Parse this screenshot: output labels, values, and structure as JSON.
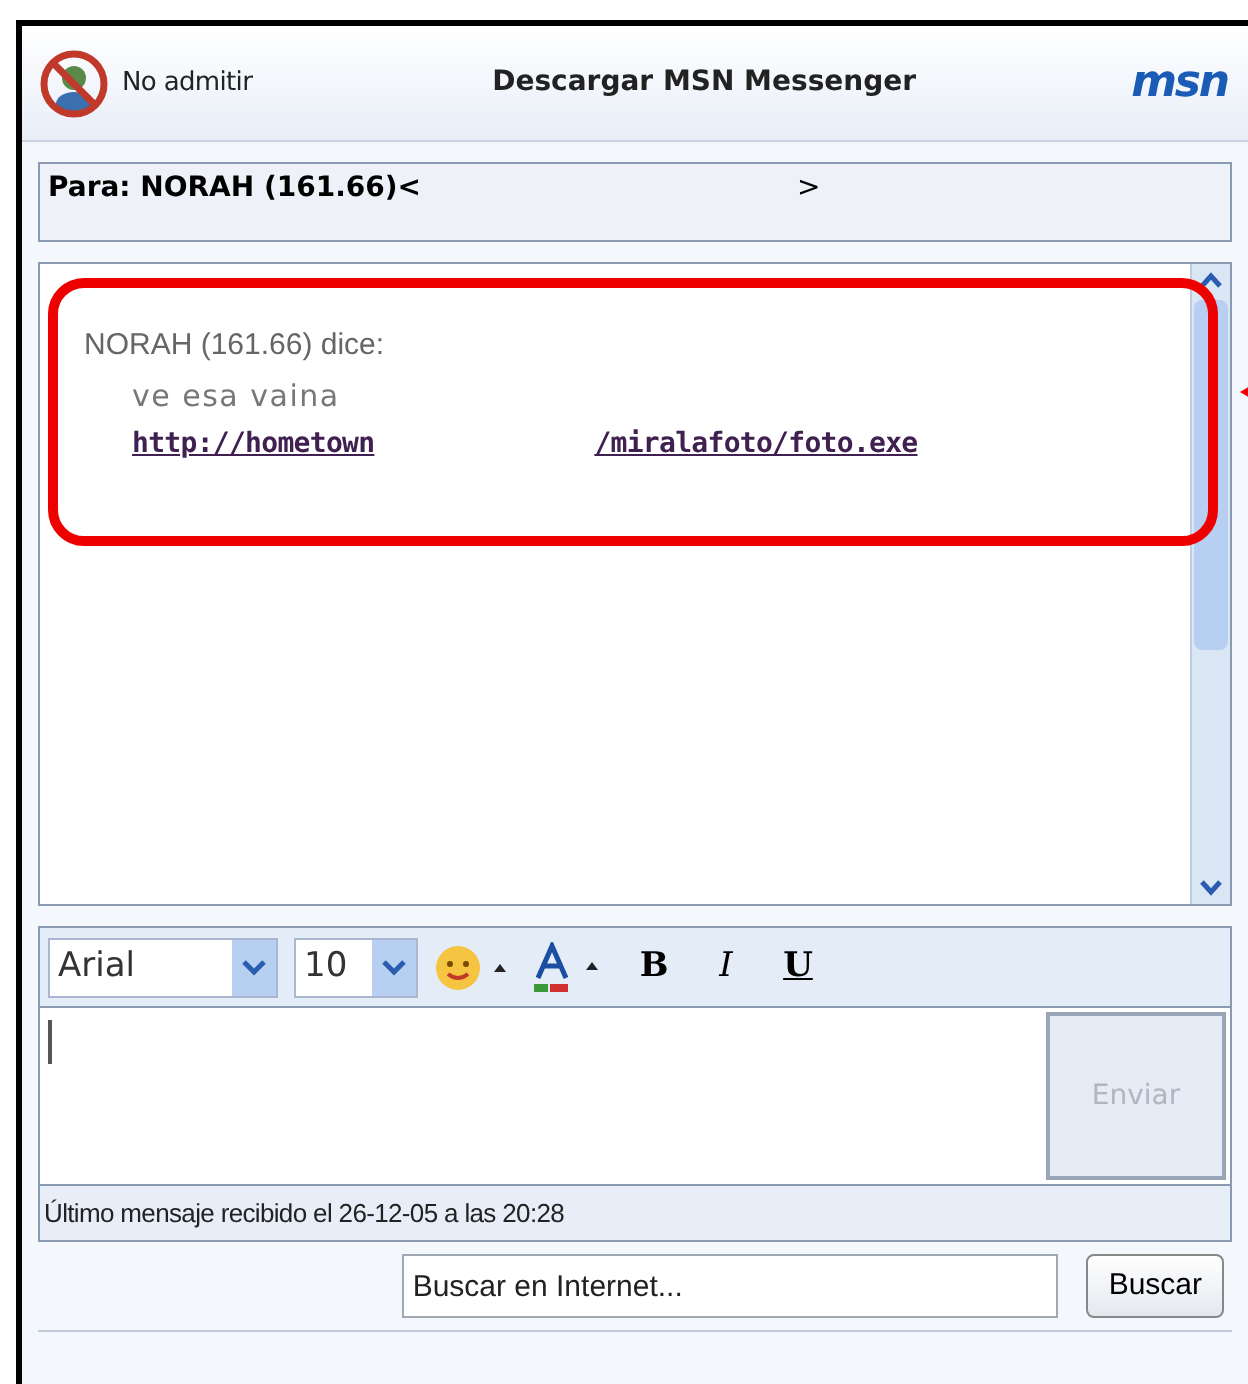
{
  "header": {
    "block_label": "No admitir",
    "download_link": "Descargar MSN Messenger",
    "logo": "msn"
  },
  "to_field": {
    "label": "Para: NORAH (161.66)<",
    "closing": ">"
  },
  "conversation": {
    "sender_line": "NORAH (161.66) dice:",
    "message": "ve esa vaina",
    "link_parts": [
      "http://hometown",
      "/miralafoto/foto.exe"
    ],
    "highlighted": true
  },
  "toolbar": {
    "font": "Arial",
    "size": "10",
    "bold": "B",
    "italic": "I",
    "underline": "U"
  },
  "compose": {
    "send_button": "Enviar",
    "send_disabled": true
  },
  "status_bar": "Último mensaje recibido el 26-12-05 a las 20:28",
  "search": {
    "placeholder": "Buscar en Internet...",
    "button": "Buscar"
  }
}
